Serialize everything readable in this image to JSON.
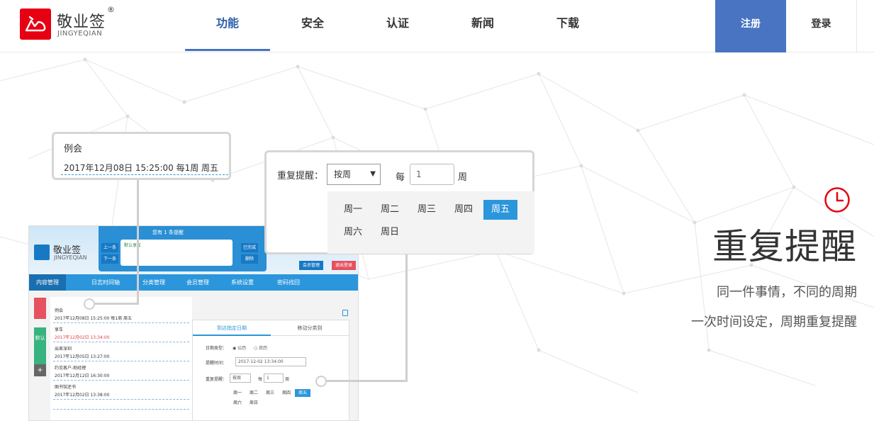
{
  "brand": {
    "name_cn": "敬业签",
    "name_en": "JINGYEQIAN",
    "reg": "®",
    "color": "#e60012"
  },
  "nav": {
    "items": [
      {
        "label": "功能"
      },
      {
        "label": "安全"
      },
      {
        "label": "认证"
      },
      {
        "label": "新闻"
      },
      {
        "label": "下载"
      }
    ],
    "active_index": 0,
    "register": "注册",
    "login": "登录",
    "accent": "#4874c2"
  },
  "event_popup": {
    "title": "例会",
    "detail": "2017年12月08日  15:25:00  每1周  周五"
  },
  "repeat_popup": {
    "label": "重复提醒：",
    "select_value": "按周",
    "every": "每",
    "number": "1",
    "unit": "周",
    "days": [
      "周一",
      "周二",
      "周三",
      "周四",
      "周五",
      "周六",
      "周日"
    ],
    "selected_day": "周五"
  },
  "mock_app": {
    "logo_cn": "敬业签",
    "logo_en": "JINGYEQIAN",
    "panel_title": "您有 1 条提醒",
    "note_text": "默认享车",
    "btn_prev": "上一条",
    "btn_next": "下一条",
    "btn_done": "已完成",
    "btn_delete": "删除",
    "btn_member": "会员管理",
    "btn_logout": "退出登录",
    "nav": [
      "内容管理",
      "日志时间轴",
      "分类管理",
      "会员管理",
      "系统设置",
      "密码找回"
    ],
    "side_tab": "默认",
    "side_plus": "+",
    "list": [
      {
        "title": "例会",
        "time": "2017年12月08日 15:25:00 每1周 周五",
        "red": false
      },
      {
        "title": "享车",
        "time": "2017年12月02日 13:34:00",
        "red": true
      },
      {
        "title": "出差深圳",
        "time": "2017年12月05日 13:27:00",
        "red": false
      },
      {
        "title": "约见客户-助经理",
        "time": "2017年12月12日 16:30:00",
        "red": false
      },
      {
        "title": "图书馆还书",
        "time": "2017年12月02日 13:38:00",
        "red": false
      }
    ],
    "form": {
      "tab_active": "到达指定日期",
      "tab_other": "移动分类到",
      "date_type_label": "日期类型：",
      "date_type_solar": "公历",
      "date_type_lunar": "农历",
      "time_label": "提醒时间：",
      "time_value": "2017-12-02 13:34:00",
      "repeat_label": "重复提醒：",
      "repeat_value": "按周",
      "every": "每",
      "number": "1",
      "unit": "周",
      "days": [
        "周一",
        "周二",
        "周三",
        "周四",
        "周五",
        "周六",
        "周日"
      ],
      "selected_day": "周五"
    }
  },
  "feature": {
    "title": "重复提醒",
    "line1": "同一件事情，不同的周期",
    "line2": "一次时间设定，周期重复提醒",
    "icon": "clock-icon",
    "icon_color": "#e60012"
  }
}
